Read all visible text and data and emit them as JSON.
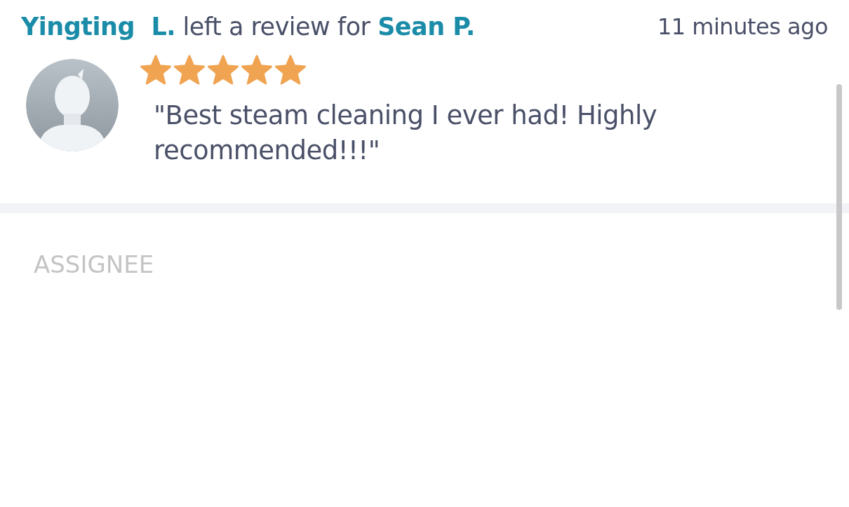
{
  "review": {
    "reviewer": "Yingting  L.",
    "action": "left a review for",
    "reviewee": "Sean P.",
    "time": "11 minutes ago",
    "stars": 5,
    "text": "\"Best steam cleaning I ever had! Highly recommended!!!\""
  },
  "section": {
    "heading": "ASSIGNEE"
  }
}
